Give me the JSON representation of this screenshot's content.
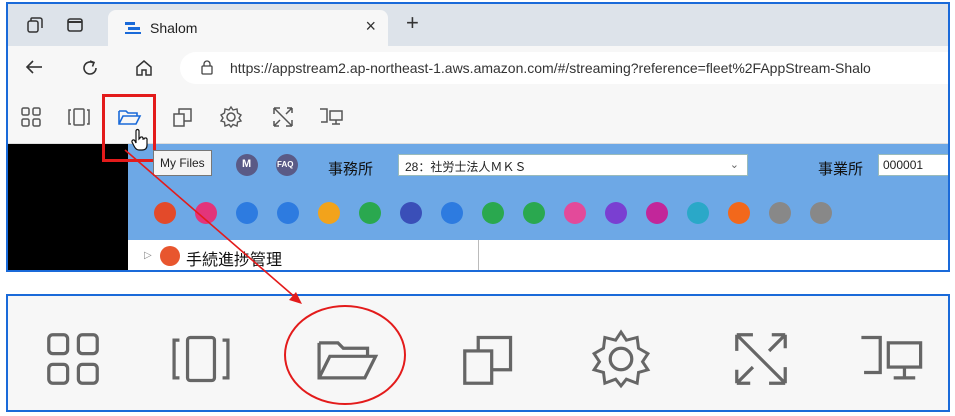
{
  "browser": {
    "tab_title": "Shalom",
    "close_glyph": "×",
    "new_tab_glyph": "+",
    "url": "https://appstream2.ap-northeast-1.aws.amazon.com/#/streaming?reference=fleet%2FAppStream-Shalo"
  },
  "appstream_toolbar": {
    "tooltip": "My Files",
    "icons": [
      "catalog-icon",
      "desktop-view-icon",
      "my-files-icon",
      "clipboard-icon",
      "settings-icon",
      "fullscreen-icon",
      "multi-monitor-icon"
    ]
  },
  "app": {
    "mini_labels": [
      "M",
      "FAQ"
    ],
    "office_label": "事務所",
    "office_value": "28：社労士法人ＭＫＳ",
    "business_label": "事業所",
    "business_value": "000001",
    "tree_item": "手続進捗管理",
    "icon_colors": [
      "#e34a2a",
      "#e3347a",
      "#2d7be0",
      "#2d7be0",
      "#f2a31b",
      "#2aa84f",
      "#3a4fb8",
      "#2d7be0",
      "#2aa84f",
      "#2aa84f",
      "#e34a9a",
      "#7a3fd1",
      "#c2269a",
      "#2aa8c8",
      "#f2681b",
      "#888888",
      "#888888"
    ]
  },
  "colors": {
    "highlight": "#e31b1b",
    "frame": "#1a6ad9",
    "app_header": "#6da8e6"
  }
}
